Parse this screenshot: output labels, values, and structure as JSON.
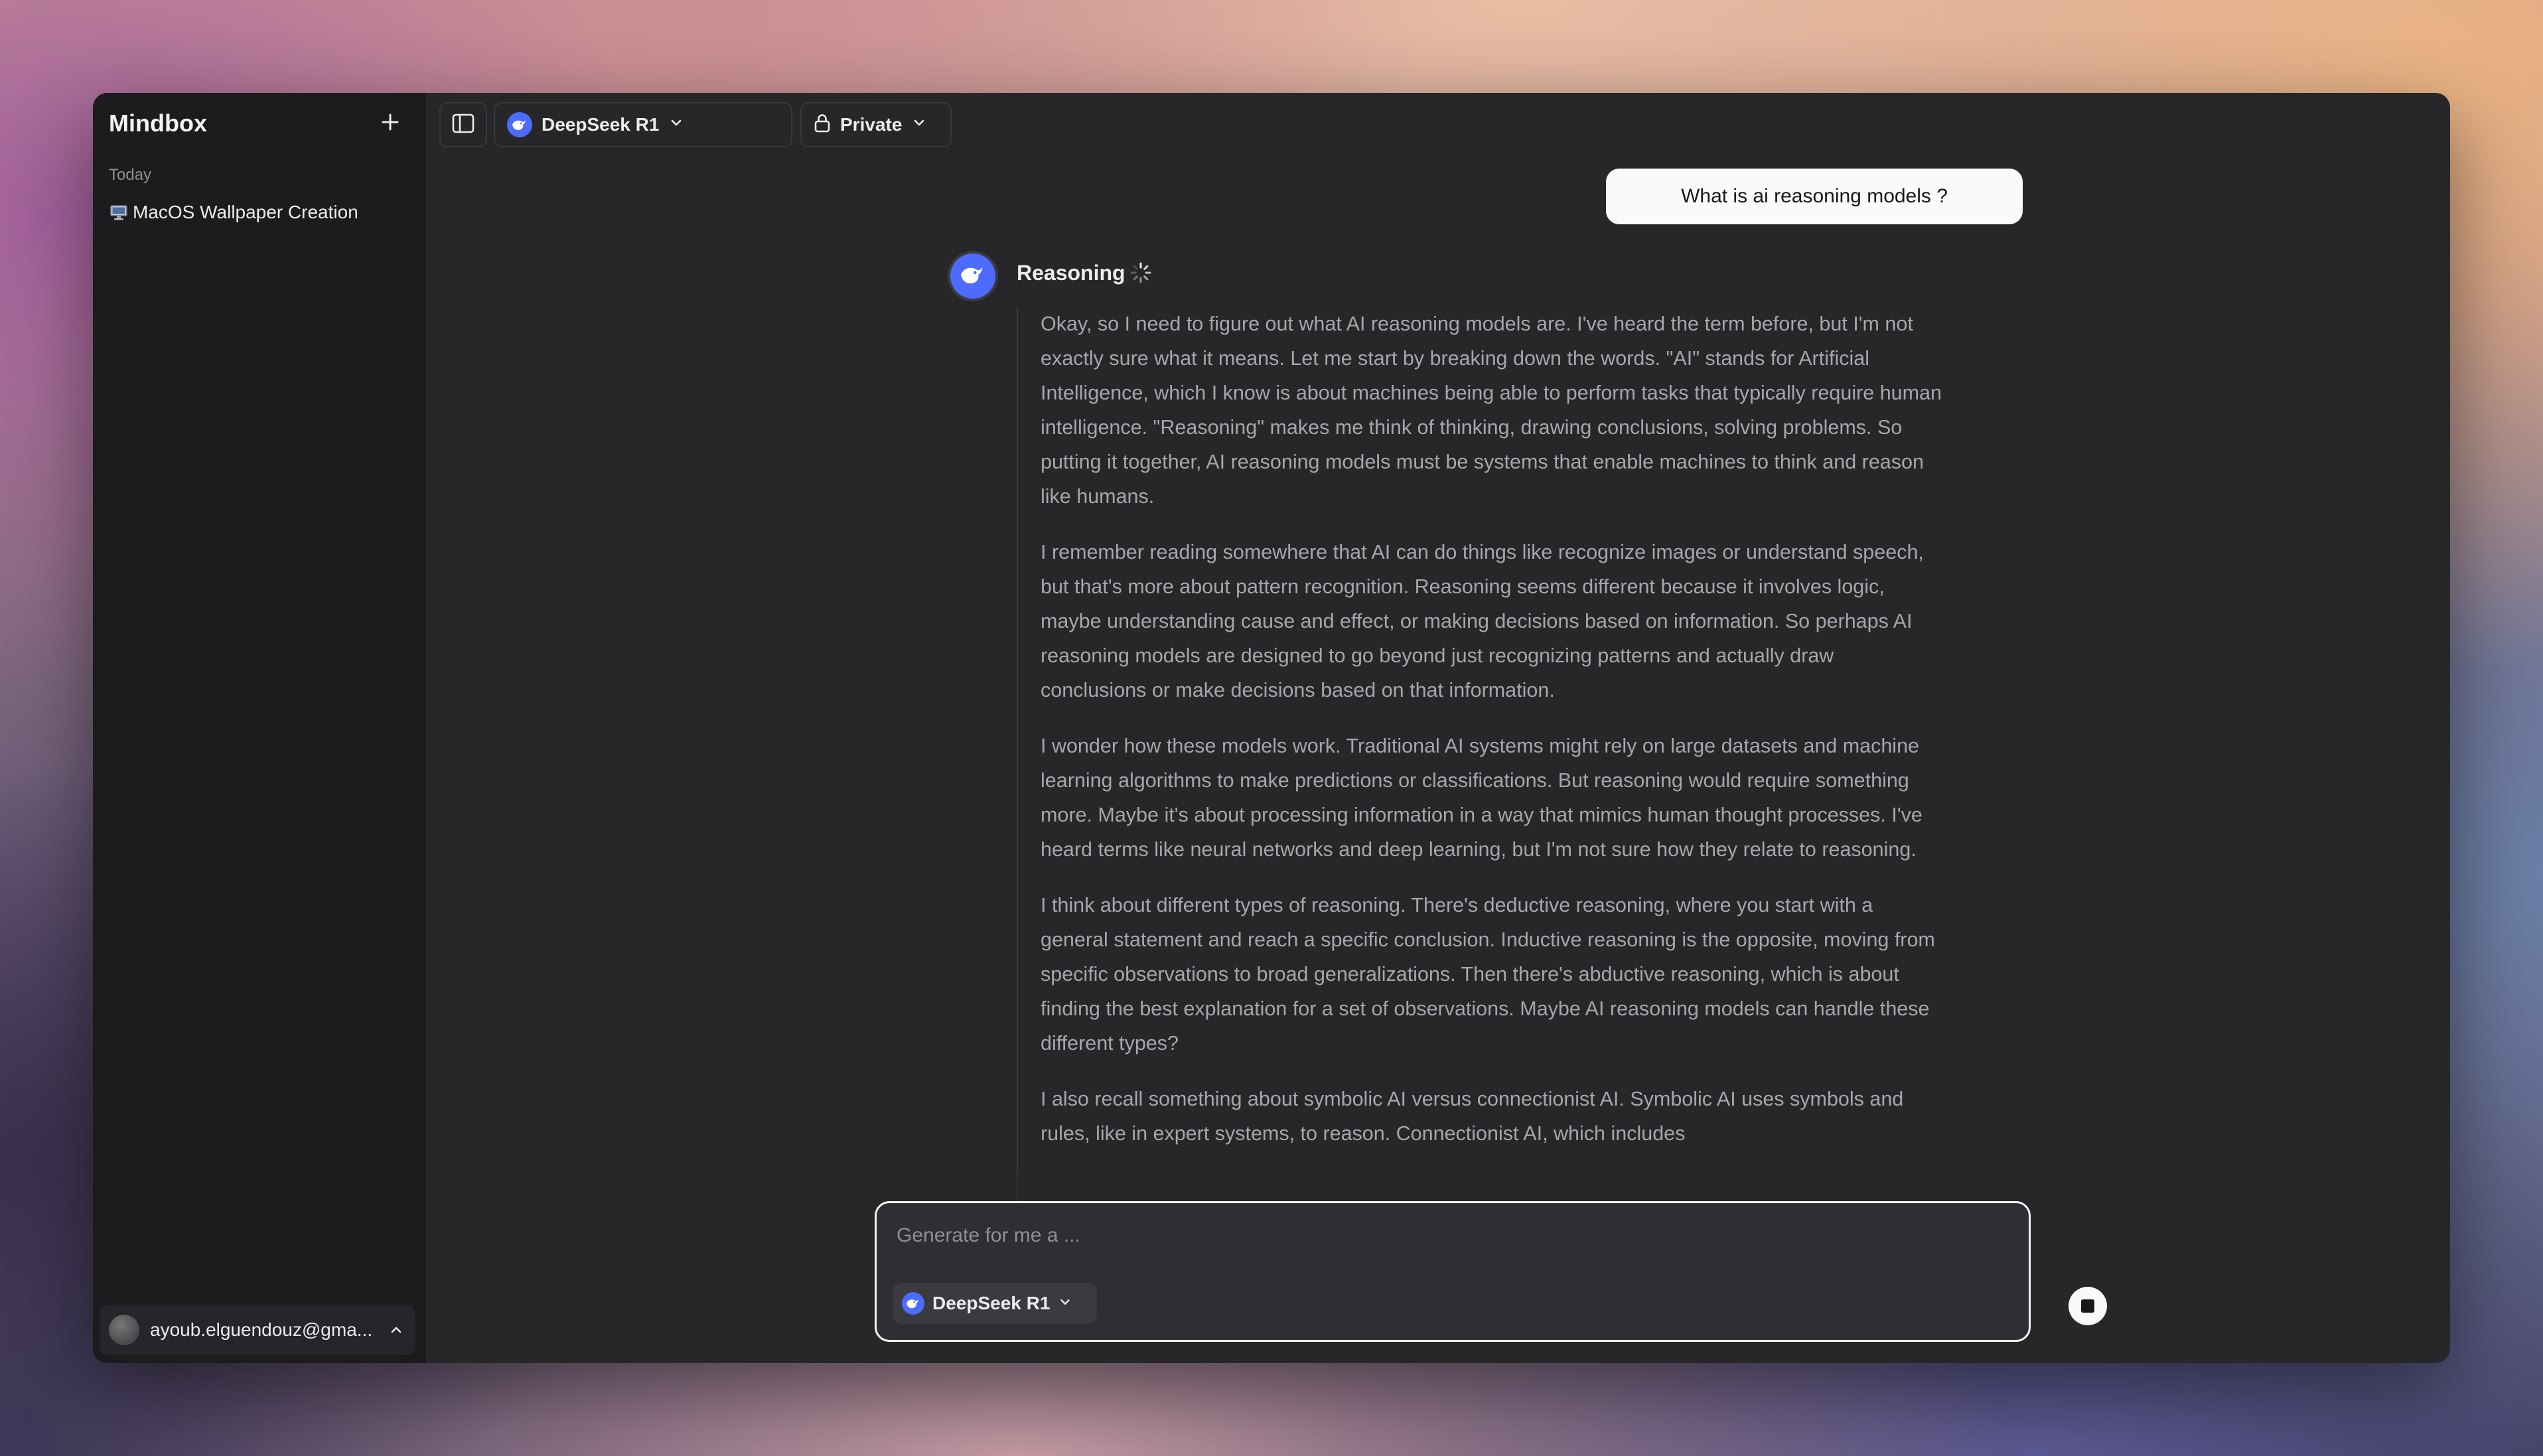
{
  "app": {
    "title": "Mindbox"
  },
  "sidebar": {
    "section_label": "Today",
    "chats": [
      {
        "label": "MacOS Wallpaper Creation",
        "icon": "monitor-icon"
      }
    ],
    "user": {
      "email": "ayoub.elguendouz@gma..."
    }
  },
  "toolbar": {
    "model_label": "DeepSeek R1",
    "visibility_label": "Private"
  },
  "conversation": {
    "user_message": "What is ai reasoning models ?",
    "assistant": {
      "status_label": "Reasoning",
      "paragraphs": [
        "Okay, so I need to figure out what AI reasoning models are. I've heard the term before, but I'm not exactly sure what it means. Let me start by breaking down the words. \"AI\" stands for Artificial Intelligence, which I know is about machines being able to perform tasks that typically require human intelligence. \"Reasoning\" makes me think of thinking, drawing conclusions, solving problems. So putting it together, AI reasoning models must be systems that enable machines to think and reason like humans.",
        "I remember reading somewhere that AI can do things like recognize images or understand speech, but that's more about pattern recognition. Reasoning seems different because it involves logic, maybe understanding cause and effect, or making decisions based on information. So perhaps AI reasoning models are designed to go beyond just recognizing patterns and actually draw conclusions or make decisions based on that information.",
        "I wonder how these models work. Traditional AI systems might rely on large datasets and machine learning algorithms to make predictions or classifications. But reasoning would require something more. Maybe it's about processing information in a way that mimics human thought processes. I've heard terms like neural networks and deep learning, but I'm not sure how they relate to reasoning.",
        "I think about different types of reasoning. There's deductive reasoning, where you start with a general statement and reach a specific conclusion. Inductive reasoning is the opposite, moving from specific observations to broad generalizations. Then there's abductive reasoning, which is about finding the best explanation for a set of observations. Maybe AI reasoning models can handle these different types?",
        "I also recall something about symbolic AI versus connectionist AI. Symbolic AI uses symbols and rules, like in expert systems, to reason. Connectionist AI, which includes"
      ]
    }
  },
  "composer": {
    "placeholder": "Generate for me a ...",
    "model_label": "DeepSeek R1"
  },
  "colors": {
    "window_bg": "#27272a",
    "sidebar_bg": "#1c1c1e",
    "accent_deepseek": "#4d6bfe"
  }
}
